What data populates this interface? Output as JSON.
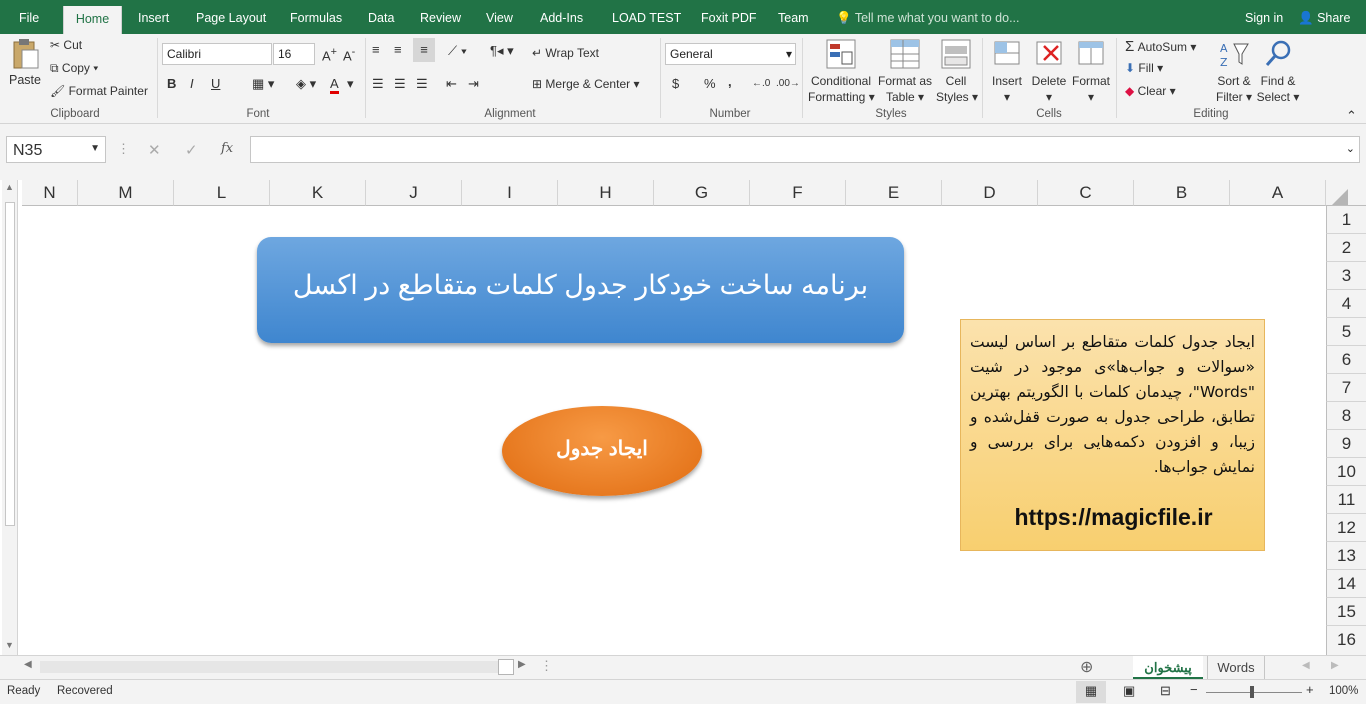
{
  "tabs": [
    "File",
    "Home",
    "Insert",
    "Page Layout",
    "Formulas",
    "Data",
    "Review",
    "View",
    "Add-Ins",
    "LOAD TEST",
    "Foxit PDF",
    "Team"
  ],
  "tell_me": "Tell me what you want to do...",
  "signin": "Sign in",
  "share": "Share",
  "clipboard": {
    "paste": "Paste",
    "cut": "Cut",
    "copy": "Copy",
    "format_painter": "Format Painter",
    "label": "Clipboard"
  },
  "font": {
    "name": "Calibri",
    "size": "16",
    "bold": "B",
    "italic": "I",
    "underline": "U",
    "label": "Font",
    "accent_color": "#e00000"
  },
  "alignment": {
    "wrap": "Wrap Text",
    "merge": "Merge & Center",
    "label": "Alignment"
  },
  "number": {
    "format": "General",
    "currency": "$",
    "percent": "%",
    "comma": ",",
    "label": "Number"
  },
  "styles": {
    "conditional": "Conditional",
    "conditional2": "Formatting",
    "format_as": "Format as",
    "format_as2": "Table",
    "cell": "Cell",
    "cell2": "Styles",
    "label": "Styles"
  },
  "cells": {
    "insert": "Insert",
    "delete": "Delete",
    "format": "Format",
    "label": "Cells"
  },
  "editing": {
    "autosum": "AutoSum",
    "fill": "Fill",
    "clear": "Clear",
    "sort": "Sort &",
    "sort2": "Filter",
    "find": "Find &",
    "find2": "Select",
    "label": "Editing"
  },
  "namebox": "N35",
  "fx": "fx",
  "columns": [
    "N",
    "M",
    "L",
    "K",
    "J",
    "I",
    "H",
    "G",
    "F",
    "E",
    "D",
    "C",
    "B",
    "A"
  ],
  "rows": [
    "1",
    "2",
    "3",
    "4",
    "5",
    "6",
    "7",
    "8",
    "9",
    "10",
    "11",
    "12",
    "13",
    "14",
    "15",
    "16"
  ],
  "sheet": {
    "title": "برنامه ساخت خودکار جدول کلمات متقاطع  در اکسل",
    "button": "ایجاد جدول",
    "info": "ایجاد جدول کلمات متقاطع بر اساس لیست «سوالات و جواب‌ها»ی موجود در شیت \"Words\"، چیدمان کلمات با الگوریتم بهترین تطابق، طراحی جدول به صورت قفل‌شده و زیبا، و افزودن دکمه‌هایی برای بررسی و نمایش جواب‌ها.",
    "link": "https://magicfile.ir"
  },
  "sheet_tabs": [
    "پیشخوان",
    "Words"
  ],
  "status": {
    "ready": "Ready",
    "recovered": "Recovered",
    "zoom": "100%"
  },
  "colors": {
    "excel_green": "#217346",
    "title_blue": "#4a8fd6",
    "button_orange": "#ee7d22",
    "info_yellow": "#fad98a"
  }
}
